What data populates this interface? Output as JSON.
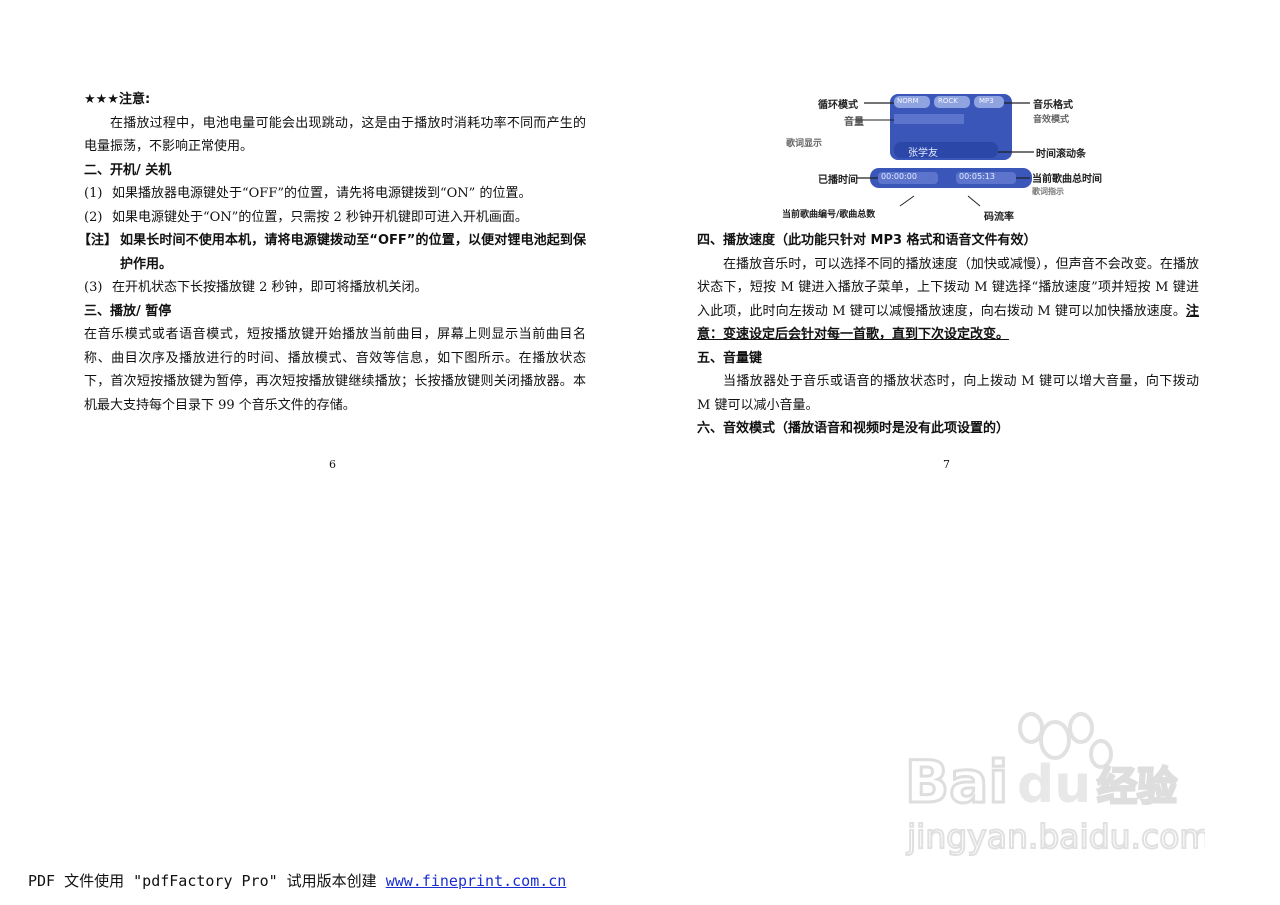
{
  "left": {
    "notice_title": "★★★注意:",
    "notice_text": "在播放过程中，电池电量可能会出现跳动，这是由于播放时消耗功率不同而产生的电量振荡，不影响正常使用。",
    "s2_heading": "二、开机/ 关机",
    "s2_items": [
      {
        "num": "(1)",
        "text": "如果播放器电源键处于“OFF”的位置，请先将电源键拨到“ON” 的位置。"
      },
      {
        "num": "(2)",
        "text": "如果电源键处于“ON”的位置，只需按 2 秒钟开机键即可进入开机画面。"
      }
    ],
    "s2_note_tag": "【注】",
    "s2_note_text": "如果长时间不使用本机，请将电源键拨动至“OFF”的位置，以便对锂电池起到保护作用。",
    "s2_item3": {
      "num": "(3)",
      "text": "在开机状态下长按播放键 2 秒钟，即可将播放机关闭。"
    },
    "s3_heading": "三、播放/ 暂停",
    "s3_text": "在音乐模式或者语音模式，短按播放键开始播放当前曲目，屏幕上则显示当前曲目名称、曲目次序及播放进行的时间、播放模式、音效等信息，如下图所示。在播放状态下，首次短按播放键为暂停，再次短按播放键继续播放；长按播放键则关闭播放器。本机最大支持每个目录下 99 个音乐文件的存储。",
    "page_number": "6"
  },
  "right": {
    "figure": {
      "labels": {
        "loop_mode": "循环模式",
        "music_format": "音乐格式",
        "volume": "音量",
        "eq_mode": "音效模式",
        "lyrics": "歌词显示",
        "song_name": "张学友",
        "time_scroll": "时间滚动条",
        "elapsed": "已播时间",
        "total_time": "当前歌曲总时间",
        "lyrics_mark": "歌词指示",
        "track_count": "当前歌曲编号/歌曲总数",
        "bitrate": "码流率",
        "screen_loop": "NORM",
        "screen_eq": "ROCK",
        "screen_format": "MP3",
        "screen_elapsed": "00:00:00",
        "screen_total": "00:05:13"
      }
    },
    "s4_heading": "四、播放速度（此功能只针对 MP3 格式和语音文件有效）",
    "s4_text": "在播放音乐时，可以选择不同的播放速度（加快或减慢），但声音不会改变。在播放状态下，短按 M 键进入播放子菜单，上下拨动 M 键选择“播放速度”项并短按 M 键进入此项，此时向左拨动 M 键可以减慢播放速度，向右拨动 M 键可以加快播放速度。",
    "s4_emphasis": "注意：变速设定后会针对每一首歌，直到下次设定改变。",
    "s5_heading": "五、音量键",
    "s5_text": "当播放器处于音乐或语音的播放状态时，向上拨动 M 键可以增大音量，向下拨动 M 键可以减小音量。",
    "s6_heading": "六、音效模式（播放语音和视频时是没有此项设置的）",
    "page_number": "7"
  },
  "footer": {
    "text": "PDF 文件使用 \"pdfFactory Pro\" 试用版本创建 ",
    "link": "www.fineprint.com.cn"
  },
  "watermark": {
    "brand": "Bai du 经验",
    "url": "jingyan.baidu.com"
  }
}
